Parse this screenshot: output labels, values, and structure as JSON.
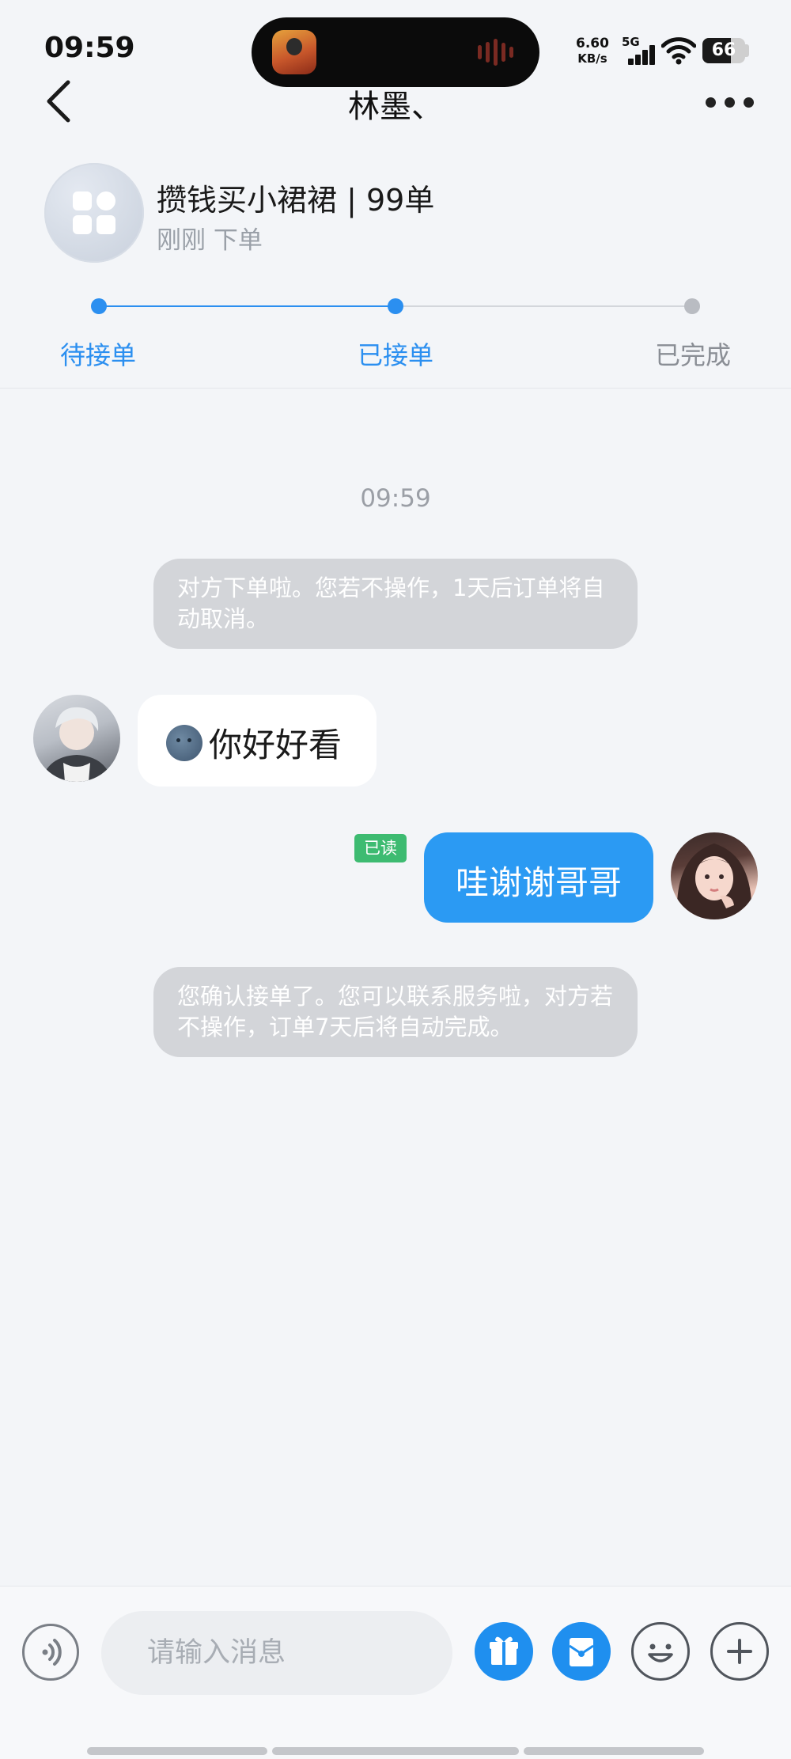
{
  "status_bar": {
    "time": "09:59",
    "net_speed_value": "6.60",
    "net_speed_unit": "KB/s",
    "network_type": "5G",
    "battery": "66"
  },
  "nav": {
    "title": "林墨、",
    "back_icon": "chevron-left-icon",
    "more_icon": "more-dots-icon"
  },
  "order": {
    "title": "攒钱买小裙裙 | 99单",
    "sub": "刚刚 下单",
    "icon": "apps-grid-icon"
  },
  "progress": {
    "steps": [
      "待接单",
      "已接单",
      "已完成"
    ],
    "current_step": 2,
    "active_color": "#2b8ff0",
    "inactive_color": "#b9bcc2"
  },
  "chat": {
    "time": "09:59",
    "system_msg_1": "对方下单啦。您若不操作，1天后订单将自动取消。",
    "incoming_text": "你好好看",
    "incoming_emoji": "moon-face-emoji",
    "outgoing_text": "哇谢谢哥哥",
    "read_badge": "已读",
    "system_msg_2": "您确认接单了。您可以联系服务啦，对方若不操作，订单7天后将自动完成。"
  },
  "input_bar": {
    "placeholder": "请输入消息",
    "icons": [
      "voice-icon",
      "gift-icon",
      "red-packet-icon",
      "emoji-icon",
      "plus-icon"
    ],
    "accent_color": "#1f8fef"
  }
}
